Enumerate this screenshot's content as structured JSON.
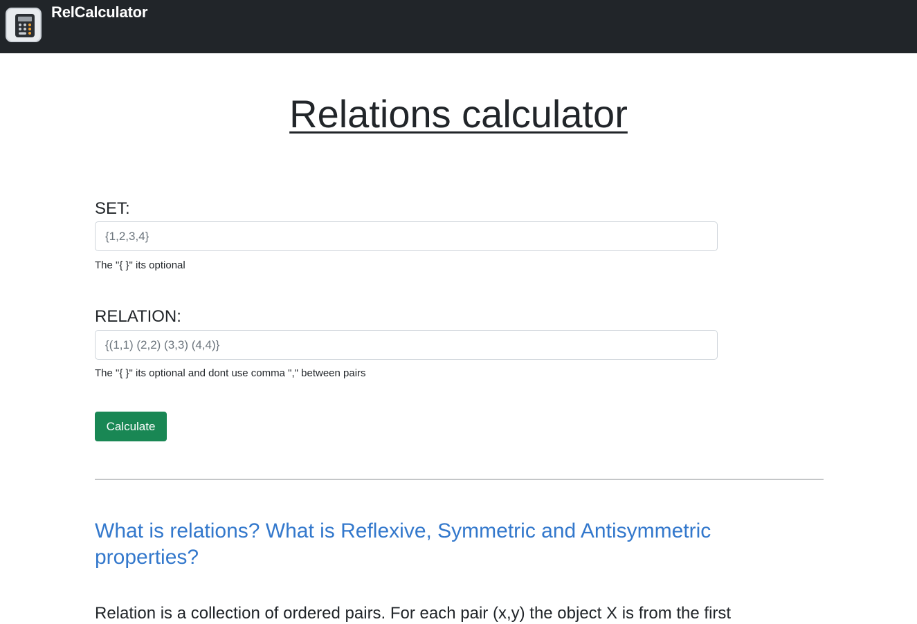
{
  "navbar": {
    "brand": "RelCalculator",
    "logo_icon": "calculator-icon"
  },
  "main": {
    "title": "Relations calculator",
    "set_field": {
      "label": "SET:",
      "placeholder": "{1,2,3,4}",
      "help": "The \"{ }\" its optional"
    },
    "relation_field": {
      "label": "RELATION:",
      "placeholder": "{(1,1) (2,2) (3,3) (4,4)}",
      "help": "The \"{ }\" its optional and dont use comma \",\" between pairs"
    },
    "calculate_label": "Calculate",
    "calculate_color": "#198754"
  },
  "info": {
    "heading": "What is relations? What is Reflexive, Symmetric and Antisymmetric properties?",
    "heading_color": "#3378cc",
    "body_start": "Relation is a collection of ordered pairs. For each pair (x,y) the object X is from the first"
  }
}
